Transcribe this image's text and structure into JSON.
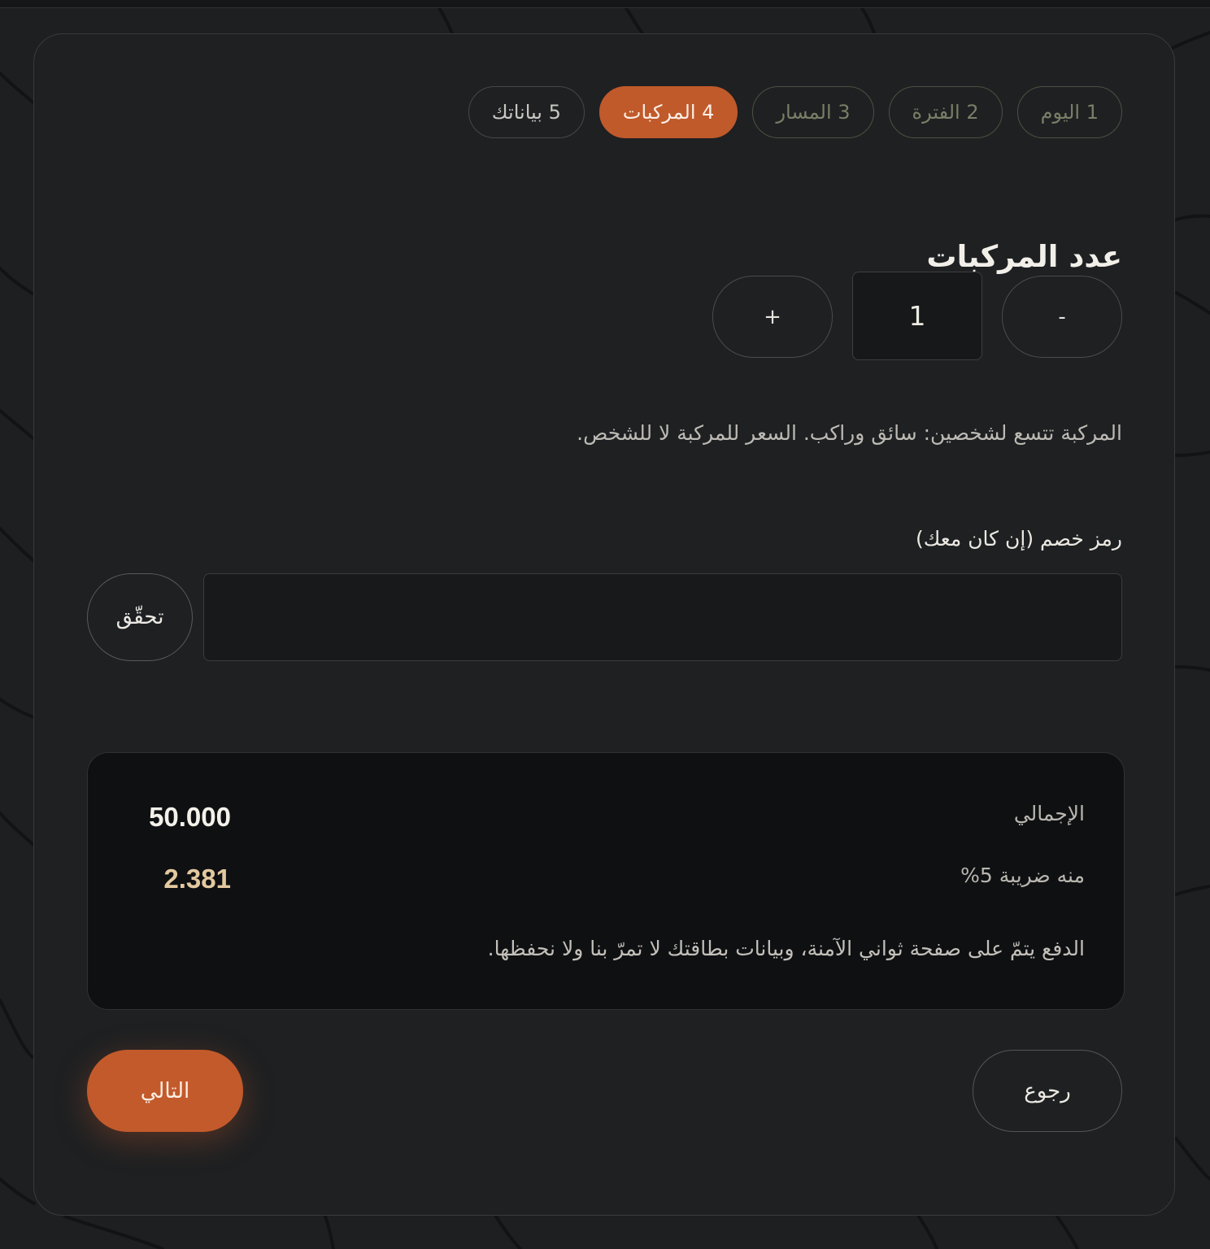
{
  "steps": [
    {
      "label": "1 اليوم",
      "state": "completed"
    },
    {
      "label": "2 الفترة",
      "state": "completed"
    },
    {
      "label": "3 المسار",
      "state": "completed"
    },
    {
      "label": "4 المركبات",
      "state": "current"
    },
    {
      "label": "5 بياناتك",
      "state": "upcoming"
    }
  ],
  "vehicles": {
    "title": "عدد المركبات",
    "minus_label": "-",
    "quantity": "1",
    "plus_label": "+",
    "note": "المركبة تتسع لشخصين: سائق وراكب. السعر للمركبة لا للشخص."
  },
  "discount": {
    "label": "رمز خصم (إن كان معك)",
    "value": "",
    "verify_label": "تحقّق"
  },
  "summary": {
    "total_label": "الإجمالي",
    "total_value": "50.000",
    "tax_label": "منه ضريبة 5%",
    "tax_value": "2.381",
    "secure_note": "الدفع يتمّ على صفحة ثواني الآمنة، وبيانات بطاقتك لا تمرّ بنا ولا نحفظها."
  },
  "actions": {
    "back_label": "رجوع",
    "next_label": "التالي"
  },
  "colors": {
    "accent": "#c05a2b",
    "background": "#1d1f21",
    "card": "#1e2022",
    "summary_bg": "#0f1012",
    "tax_value": "#e3c9a0",
    "completed_step": "#7b7e66"
  }
}
